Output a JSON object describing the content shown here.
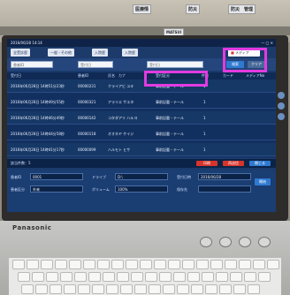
{
  "background": {
    "notes": [
      "医療情",
      "防災",
      "防災　管理",
      "MATSUI"
    ]
  },
  "app": {
    "titlebar": {
      "date": "2016/06/28 14:14",
      "name": "",
      "right": ""
    },
    "tabs": [
      "全受診歴",
      "一般・その他",
      "入院歴",
      "入院歴"
    ],
    "media_button": "メディア",
    "toolbar": {
      "input1": "患者ID",
      "input2": "受付日",
      "input3": "受付日",
      "btn_search": "検索",
      "btn_clear": "クリア"
    },
    "columns": [
      "受付日",
      "患者ID",
      "氏名　カナ",
      "受付区分",
      "件数",
      "カード",
      "メディアNo"
    ],
    "rows": [
      {
        "date": "2016年06月28日 14時51分23秒",
        "id": "00000231",
        "name": "クライアビ ユキ",
        "type": "事前記載・テール",
        "count": "1"
      },
      {
        "date": "2016年06月28日 14時49分55秒",
        "id": "00000321",
        "name": "アラリエ サエタ",
        "type": "事前記載・テール",
        "count": "1"
      },
      {
        "date": "2016年06月28日 14時46分49秒",
        "id": "00000142",
        "name": "コタダアリ ハルヨ",
        "type": "事前記載・テール",
        "count": "1"
      },
      {
        "date": "2016年06月28日 14時44分58秒",
        "id": "00000118",
        "name": "オオネヤ ケイジ",
        "type": "事前記載・テール",
        "count": "1"
      },
      {
        "date": "2016年06月28日 14時41分17秒",
        "id": "00000099",
        "name": "ハルモト ヒサ",
        "type": "事前記載・テール",
        "count": "1"
      }
    ],
    "status": {
      "count_text": "該当件数：5",
      "btn_a": "印刷",
      "btn_b": "再送信",
      "btn_c": "閉じる"
    },
    "detail": {
      "label1": "患者ID",
      "value1": "0001",
      "label2": "ドライブ",
      "value2": "D:\\",
      "label3": "受付日時",
      "value3": "2016/06/28",
      "label4": "患者区分",
      "value4": "外来",
      "label5": "ボリューム",
      "value5": "100%",
      "label6": "保存先",
      "value6": "",
      "btn": "開始"
    }
  },
  "laptop": {
    "brand": "Panasonic"
  },
  "colors": {
    "highlight": "#e23be0",
    "screen": "#1a3a6c",
    "accent": "#d9342b"
  }
}
